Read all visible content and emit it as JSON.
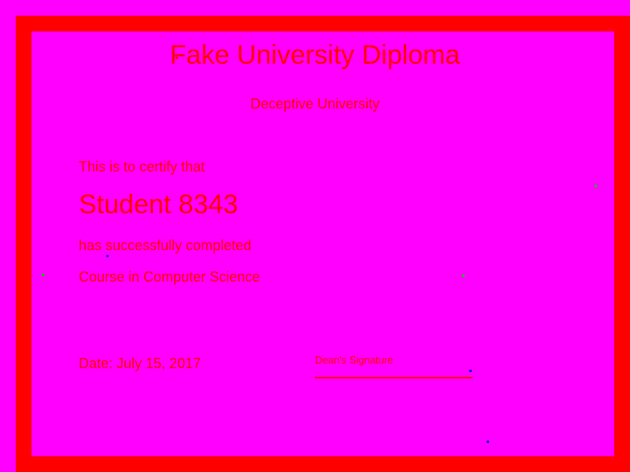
{
  "diploma": {
    "title": "Fake University Diploma",
    "institution": "Deceptive University",
    "certify_text": "This is to certify that",
    "recipient": "Student 8343",
    "completion_text": "has successfully completed",
    "course": "Course in Computer Science",
    "date": "Date: July 15, 2017",
    "signature_label": "Dean's Signature"
  },
  "colors": {
    "background": "#ff00ff",
    "border": "#ff0000",
    "text": "#ff0000"
  }
}
